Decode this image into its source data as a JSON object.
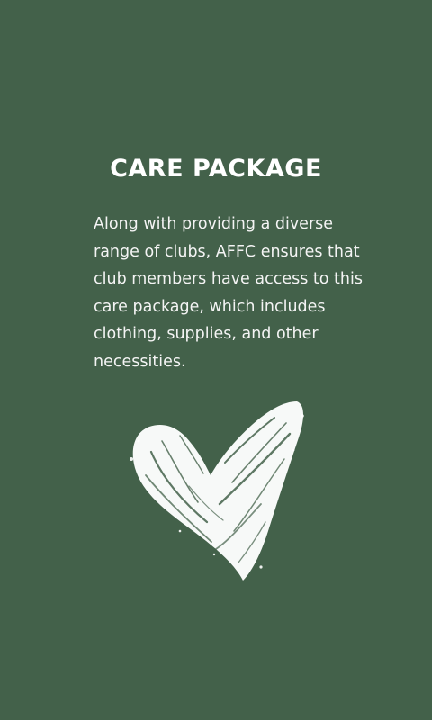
{
  "card": {
    "title": "CARE PACKAGE",
    "body": "Along with providing a diverse range of clubs, AFFC ensures that club members have access to this care package, which includes clothing, supplies, and other necessities.",
    "heart_icon": "heart-icon",
    "colors": {
      "background": "#43614a",
      "text": "#ffffff"
    }
  }
}
